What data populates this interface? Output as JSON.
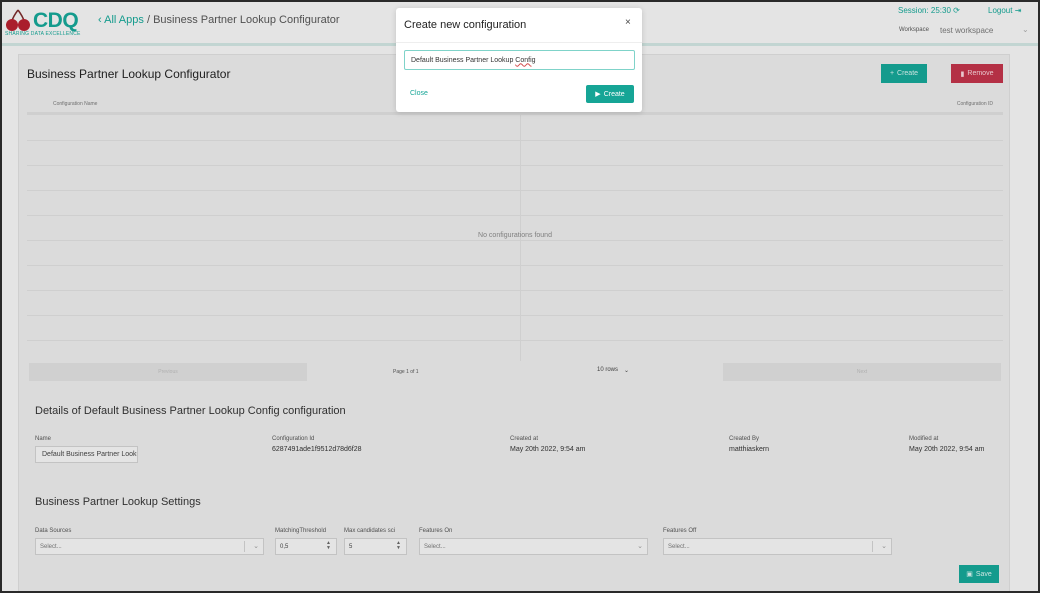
{
  "header": {
    "logo_text": "CDQ",
    "logo_tagline": "SHARING DATA EXCELLENCE",
    "breadcrumb_back": "All Apps",
    "breadcrumb_separator": "/",
    "breadcrumb_current": "Business Partner Lookup Configurator",
    "session": "Session: 25:30",
    "logout": "Logout",
    "workspace_label": "Workspace",
    "workspace_value": "test workspace"
  },
  "main": {
    "title": "Business Partner Lookup Configurator",
    "create_label": "Create",
    "remove_label": "Remove",
    "table": {
      "col_name": "Configuration Name",
      "col_id": "Configuration ID",
      "empty_message": "No configurations found"
    },
    "pager": {
      "previous": "Previous",
      "info": "Page 1 of 1",
      "rows": "10 rows",
      "next": "Next"
    }
  },
  "details": {
    "title": "Details of Default Business Partner Lookup Config configuration",
    "name_label": "Name",
    "name_value": "Default Business Partner Lookup Config",
    "id_label": "Configuration Id",
    "id_value": "6287491ade1f9512d78d6f28",
    "created_at_label": "Created at",
    "created_at_value": "May 20th 2022, 9:54 am",
    "created_by_label": "Created By",
    "created_by_value": "matthiaskern",
    "modified_at_label": "Modified at",
    "modified_at_value": "May 20th 2022, 9:54 am"
  },
  "settings": {
    "title": "Business Partner Lookup Settings",
    "data_sources_label": "Data Sources",
    "data_sources_placeholder": "Select...",
    "threshold_label": "MatchingThreshold",
    "threshold_value": "0,5",
    "max_candidates_label": "Max candidates sci",
    "max_candidates_value": "5",
    "features_on_label": "Features On",
    "features_on_placeholder": "Select...",
    "features_off_label": "Features Off",
    "features_off_placeholder": "Select...",
    "save_label": "Save"
  },
  "modal": {
    "title": "Create new configuration",
    "input_text": "Default Business Partner Lookup ",
    "input_text_misspelled": "Config",
    "close_label": "Close",
    "create_label": "Create"
  },
  "colors": {
    "accent": "#16a596",
    "danger": "#c0334a",
    "background": "#f3f3f3"
  },
  "icons": {
    "back": "chevron-left-icon",
    "refresh": "refresh-icon",
    "logout": "logout-icon",
    "create": "plus-icon",
    "remove": "trash-icon",
    "save": "floppy-icon",
    "modal_create": "play-icon",
    "modal_close": "close-icon"
  }
}
